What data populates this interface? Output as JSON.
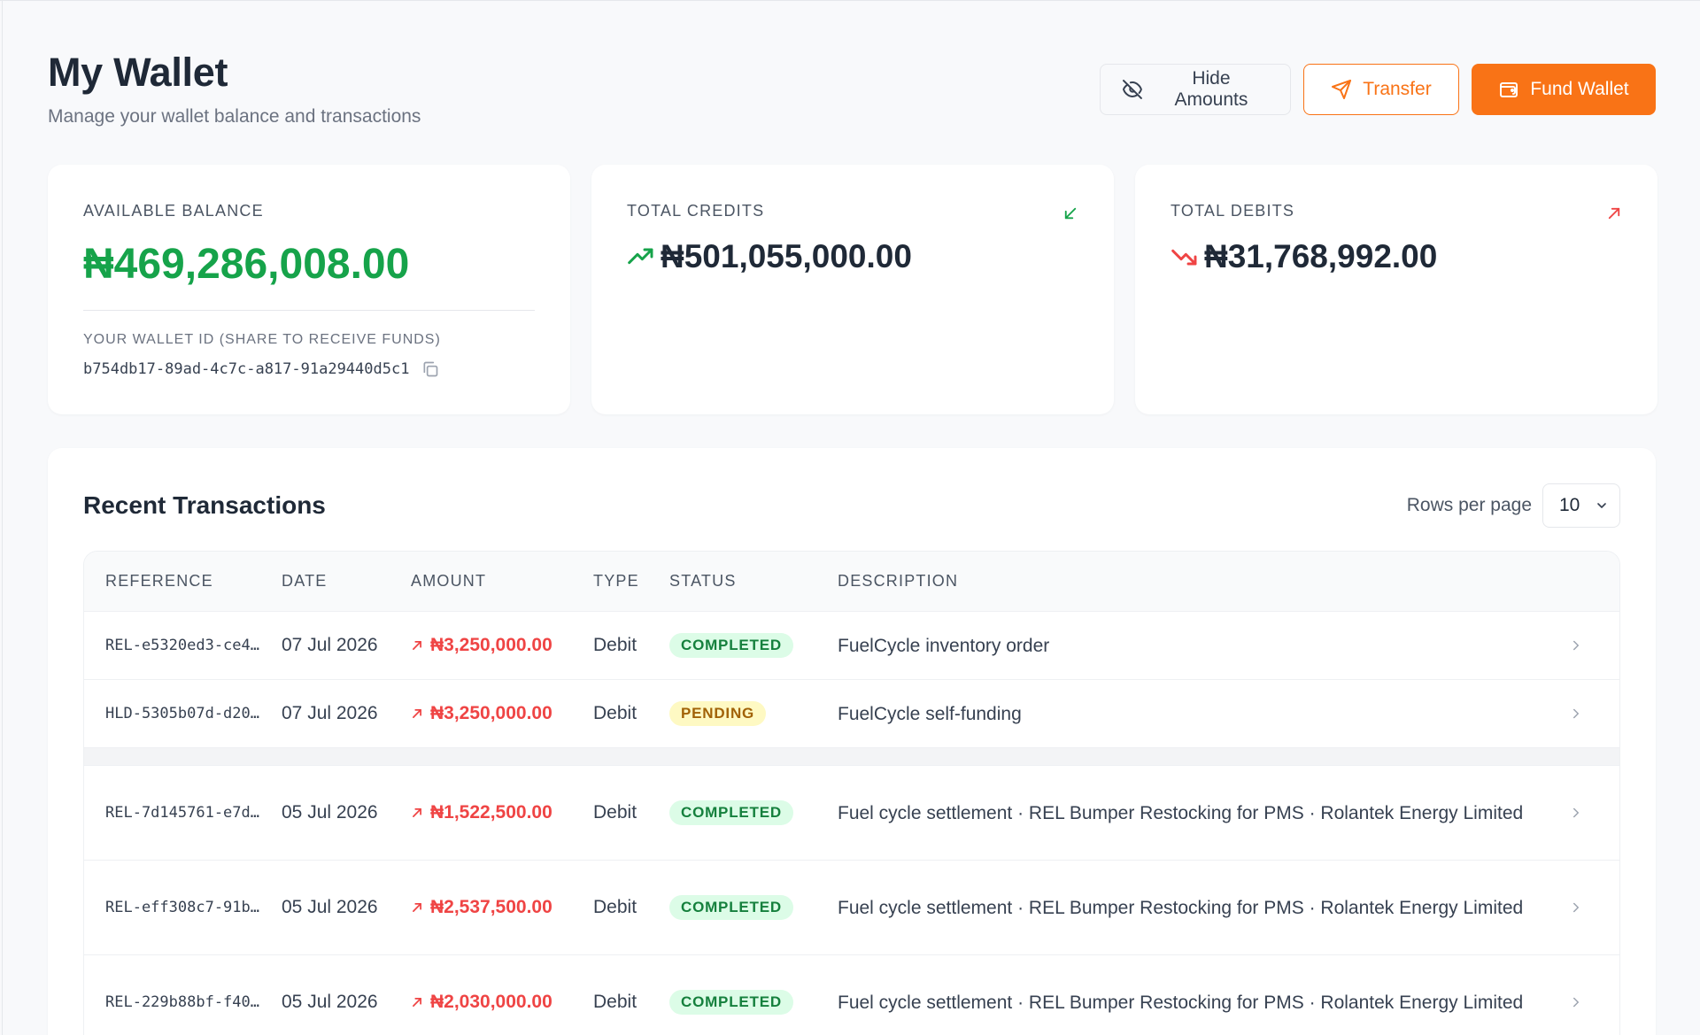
{
  "header": {
    "title": "My Wallet",
    "subtitle": "Manage your wallet balance and transactions",
    "hide_amounts_label": "Hide Amounts",
    "transfer_label": "Transfer",
    "fund_wallet_label": "Fund Wallet"
  },
  "balance_card": {
    "label": "AVAILABLE BALANCE",
    "amount": "₦469,286,008.00",
    "wallet_id_label": "YOUR WALLET ID (SHARE TO RECEIVE FUNDS)",
    "wallet_id": "b754db17-89ad-4c7c-a817-91a29440d5c1"
  },
  "credits_card": {
    "label": "TOTAL CREDITS",
    "amount": "₦501,055,000.00"
  },
  "debits_card": {
    "label": "TOTAL DEBITS",
    "amount": "₦31,768,992.00"
  },
  "transactions": {
    "title": "Recent Transactions",
    "rows_per_page_label": "Rows per page",
    "rows_per_page_value": "10",
    "columns": [
      "REFERENCE",
      "DATE",
      "AMOUNT",
      "TYPE",
      "STATUS",
      "DESCRIPTION"
    ],
    "rows": [
      {
        "reference": "REL-e5320ed3-ce4…",
        "date": "07 Jul 2026",
        "amount": "₦3,250,000.00",
        "type": "Debit",
        "status": "COMPLETED",
        "description": "FuelCycle inventory order"
      },
      {
        "reference": "HLD-5305b07d-d20…",
        "date": "07 Jul 2026",
        "amount": "₦3,250,000.00",
        "type": "Debit",
        "status": "PENDING",
        "description": "FuelCycle self-funding"
      },
      {
        "reference": "REL-7d145761-e7d…",
        "date": "05 Jul 2026",
        "amount": "₦1,522,500.00",
        "type": "Debit",
        "status": "COMPLETED",
        "description": "Fuel cycle settlement · REL Bumper Restocking for PMS · Rolantek Energy Limited"
      },
      {
        "reference": "REL-eff308c7-91b…",
        "date": "05 Jul 2026",
        "amount": "₦2,537,500.00",
        "type": "Debit",
        "status": "COMPLETED",
        "description": "Fuel cycle settlement · REL Bumper Restocking for PMS · Rolantek Energy Limited"
      },
      {
        "reference": "REL-229b88bf-f40…",
        "date": "05 Jul 2026",
        "amount": "₦2,030,000.00",
        "type": "Debit",
        "status": "COMPLETED",
        "description": "Fuel cycle settlement · REL Bumper Restocking for PMS · Rolantek Energy Limited"
      }
    ]
  },
  "colors": {
    "accent": "#f97316",
    "credit_green": "#16a34a",
    "debit_red": "#ef4444"
  }
}
